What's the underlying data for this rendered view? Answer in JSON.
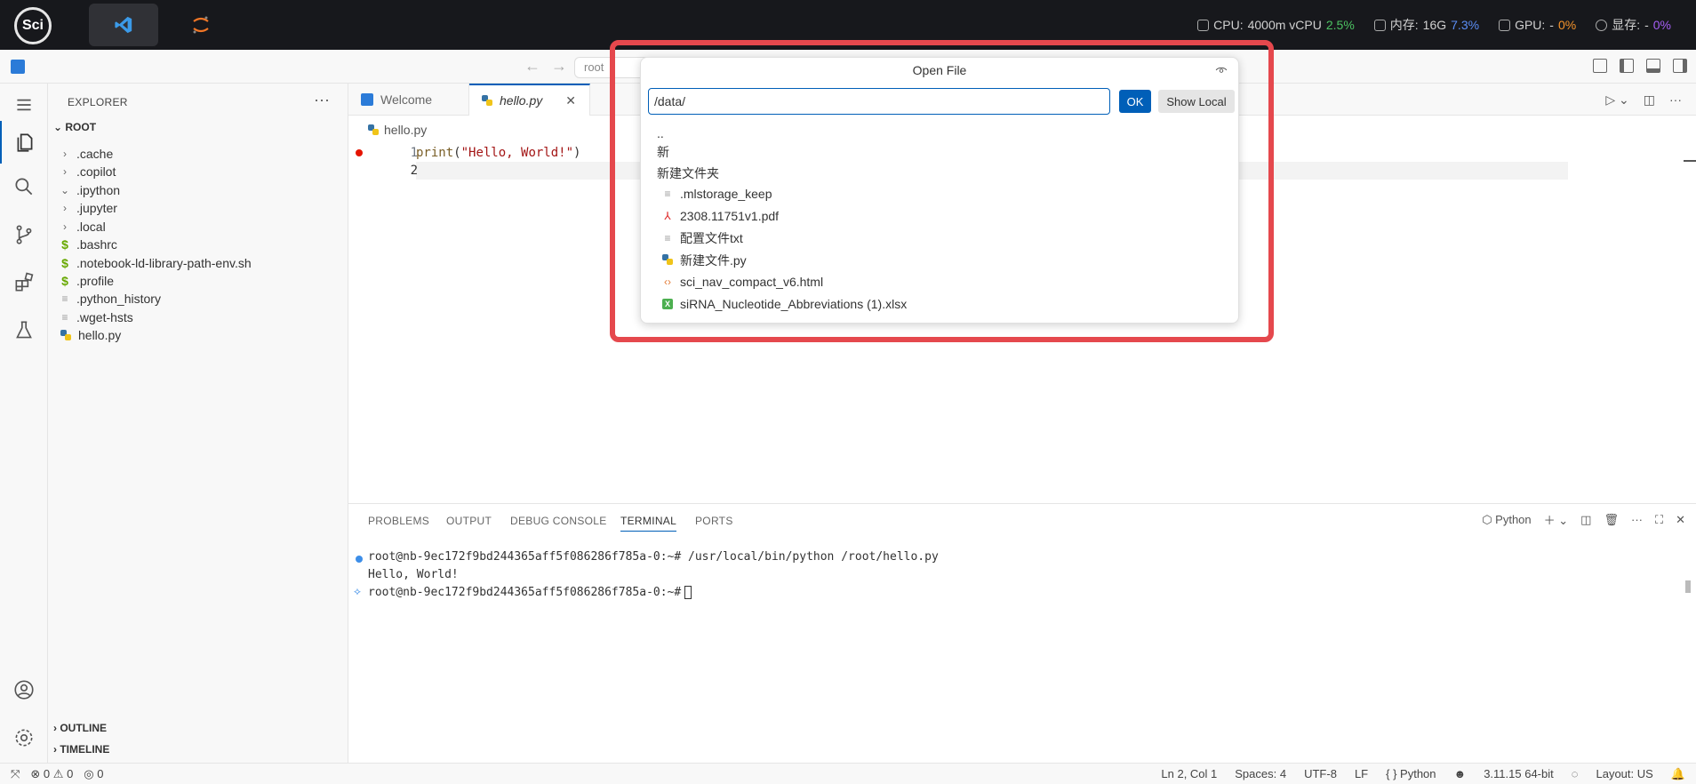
{
  "topbar": {
    "logo_text": "Sci",
    "metrics": [
      {
        "label": "CPU:",
        "value": "4000m vCPU",
        "pct": "2.5%",
        "pct_color": "#4cc262"
      },
      {
        "label": "内存:",
        "value": "16G",
        "pct": "7.3%",
        "pct_color": "#5b8ef5"
      },
      {
        "label": "GPU:",
        "value": "-",
        "pct": "0%",
        "pct_color": "#f5932b"
      },
      {
        "label": "显存:",
        "value": "-",
        "pct": "0%",
        "pct_color": "#a65ef5"
      }
    ]
  },
  "titlebar": {
    "command_center": "root"
  },
  "sidebar": {
    "header": "EXPLORER",
    "root_label": "ROOT",
    "items": [
      {
        "label": ".cache",
        "kind": "folder"
      },
      {
        "label": ".copilot",
        "kind": "folder"
      },
      {
        "label": ".ipython",
        "kind": "folder-open"
      },
      {
        "label": ".jupyter",
        "kind": "folder"
      },
      {
        "label": ".local",
        "kind": "folder"
      },
      {
        "label": ".bashrc",
        "kind": "shell"
      },
      {
        "label": ".notebook-ld-library-path-env.sh",
        "kind": "shell"
      },
      {
        "label": ".profile",
        "kind": "shell"
      },
      {
        "label": ".python_history",
        "kind": "text"
      },
      {
        "label": ".wget-hsts",
        "kind": "text"
      },
      {
        "label": "hello.py",
        "kind": "python"
      }
    ],
    "outline": "OUTLINE",
    "timeline": "TIMELINE"
  },
  "editor": {
    "tabs": [
      {
        "label": "Welcome"
      },
      {
        "label": "hello.py"
      }
    ],
    "breadcrumb": "hello.py",
    "lines": [
      {
        "num": "1",
        "fn": "print",
        "open": "(",
        "str": "\"Hello, World!\"",
        "close": ")"
      },
      {
        "num": "2"
      }
    ]
  },
  "panel": {
    "tabs": [
      "PROBLEMS",
      "OUTPUT",
      "DEBUG CONSOLE",
      "TERMINAL",
      "PORTS"
    ],
    "active_tab": "TERMINAL",
    "terminal_profile": "Python",
    "terminal": [
      "root@nb-9ec172f9bd244365aff5f086286f785a-0:~# /usr/local/bin/python /root/hello.py",
      "Hello, World!",
      "root@nb-9ec172f9bd244365aff5f086286f785a-0:~#"
    ]
  },
  "statusbar": {
    "errors": "0",
    "warnings": "0",
    "ports": "0",
    "position": "Ln 2, Col 1",
    "spaces": "Spaces: 4",
    "encoding": "UTF-8",
    "eol": "LF",
    "language": "Python",
    "interpreter": "3.11.15 64-bit",
    "layout": "Layout: US"
  },
  "dialog": {
    "title": "Open File",
    "input_value": "/data/",
    "ok_label": "OK",
    "show_local_label": "Show Local",
    "entries": [
      {
        "label": "..",
        "kind": "none"
      },
      {
        "label": "新",
        "kind": "none"
      },
      {
        "label": "新建文件夹",
        "kind": "none"
      },
      {
        "label": ".mlstorage_keep",
        "kind": "text"
      },
      {
        "label": "2308.11751v1.pdf",
        "kind": "pdf"
      },
      {
        "label": "配置文件txt",
        "kind": "text"
      },
      {
        "label": "新建文件.py",
        "kind": "python"
      },
      {
        "label": "sci_nav_compact_v6.html",
        "kind": "html"
      },
      {
        "label": "siRNA_Nucleotide_Abbreviations (1).xlsx",
        "kind": "excel"
      }
    ]
  },
  "colors": {
    "accent": "#005fb8",
    "highlight": "#e5484d",
    "breakpoint": "#e51400"
  }
}
